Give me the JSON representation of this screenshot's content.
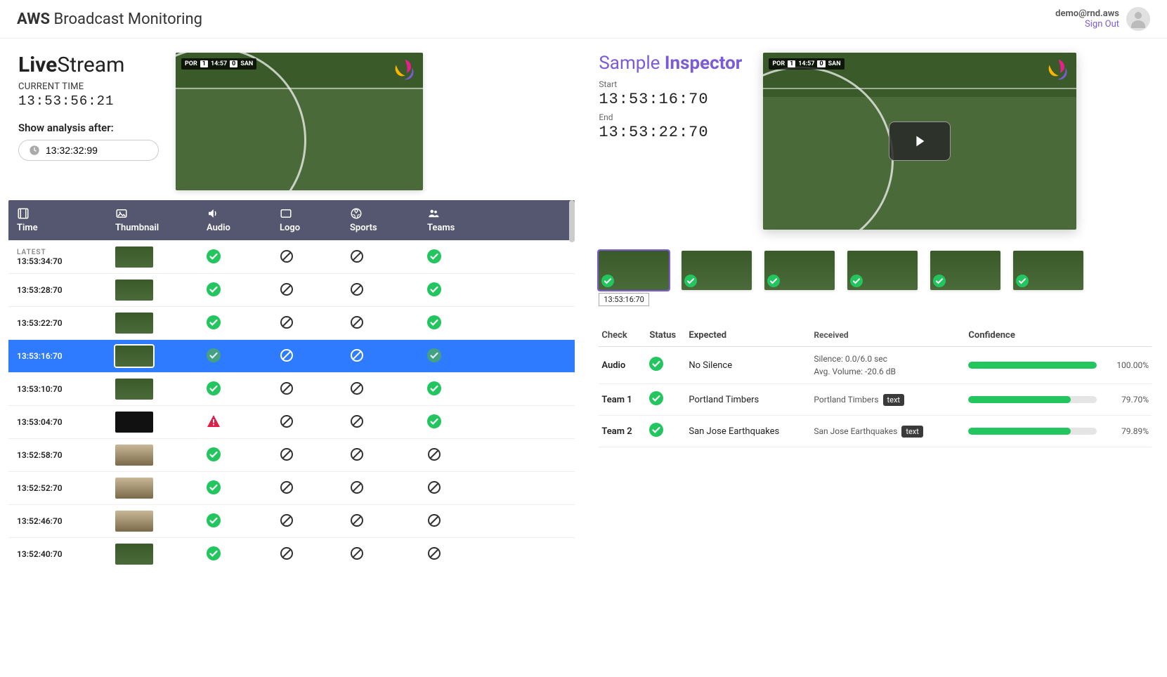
{
  "header": {
    "brand_bold": "AWS",
    "brand_rest": " Broadcast Monitoring",
    "user_email": "demo@rnd.aws",
    "sign_out": "Sign Out"
  },
  "livestream": {
    "title_bold": "Live",
    "title_rest": "Stream",
    "current_time_label": "CURRENT TIME",
    "current_time": "13:53:56:21",
    "analysis_label": "Show analysis after:",
    "analysis_value": "13:32:32:99",
    "scorebug": {
      "t1": "POR",
      "s1": "1",
      "clk": "14:57",
      "s2": "0",
      "t2": "SAN"
    }
  },
  "columns": {
    "time": "Time",
    "thumbnail": "Thumbnail",
    "audio": "Audio",
    "logo": "Logo",
    "sports": "Sports",
    "teams": "Teams"
  },
  "rows": [
    {
      "latest": "LATEST",
      "time": "13:53:34:70",
      "thumb": "field",
      "audio": "ok",
      "logo": "na",
      "sports": "na",
      "teams": "ok",
      "selected": false
    },
    {
      "latest": "",
      "time": "13:53:28:70",
      "thumb": "field",
      "audio": "ok",
      "logo": "na",
      "sports": "na",
      "teams": "ok",
      "selected": false
    },
    {
      "latest": "",
      "time": "13:53:22:70",
      "thumb": "field",
      "audio": "ok",
      "logo": "na",
      "sports": "na",
      "teams": "ok",
      "selected": false
    },
    {
      "latest": "",
      "time": "13:53:16:70",
      "thumb": "field",
      "audio": "ok",
      "logo": "na",
      "sports": "na",
      "teams": "ok",
      "selected": true
    },
    {
      "latest": "",
      "time": "13:53:10:70",
      "thumb": "field",
      "audio": "ok",
      "logo": "na",
      "sports": "na",
      "teams": "ok",
      "selected": false
    },
    {
      "latest": "",
      "time": "13:53:04:70",
      "thumb": "dark",
      "audio": "warn",
      "logo": "na",
      "sports": "na",
      "teams": "ok",
      "selected": false
    },
    {
      "latest": "",
      "time": "13:52:58:70",
      "thumb": "blur",
      "audio": "ok",
      "logo": "na",
      "sports": "na",
      "teams": "na",
      "selected": false
    },
    {
      "latest": "",
      "time": "13:52:52:70",
      "thumb": "blur",
      "audio": "ok",
      "logo": "na",
      "sports": "na",
      "teams": "na",
      "selected": false
    },
    {
      "latest": "",
      "time": "13:52:46:70",
      "thumb": "blur",
      "audio": "ok",
      "logo": "na",
      "sports": "na",
      "teams": "na",
      "selected": false
    },
    {
      "latest": "",
      "time": "13:52:40:70",
      "thumb": "field",
      "audio": "ok",
      "logo": "na",
      "sports": "na",
      "teams": "na",
      "selected": false
    }
  ],
  "inspector": {
    "title_pre": "Sample ",
    "title_bold": "Inspector",
    "start_label": "Start",
    "start_time": "13:53:16:70",
    "end_label": "End",
    "end_time": "13:53:22:70",
    "strip": [
      {
        "time": "13:53:16:70",
        "active": true
      },
      {
        "time": "",
        "active": false
      },
      {
        "time": "",
        "active": false
      },
      {
        "time": "",
        "active": false
      },
      {
        "time": "",
        "active": false
      },
      {
        "time": "",
        "active": false
      }
    ],
    "checks_header": {
      "check": "Check",
      "status": "Status",
      "expected": "Expected",
      "received": "Received",
      "confidence": "Confidence"
    },
    "checks": [
      {
        "name": "Audio",
        "status": "ok",
        "expected": "No Silence",
        "received_lines": [
          "Silence: 0.0/6.0 sec",
          "Avg. Volume: -20.6 dB"
        ],
        "tag": "",
        "confidence_pct": "100.00%",
        "confidence_val": 100
      },
      {
        "name": "Team 1",
        "status": "ok",
        "expected": "Portland Timbers",
        "received_lines": [
          "Portland Timbers"
        ],
        "tag": "text",
        "confidence_pct": "79.70%",
        "confidence_val": 79.7
      },
      {
        "name": "Team 2",
        "status": "ok",
        "expected": "San Jose Earthquakes",
        "received_lines": [
          "San Jose Earthquakes"
        ],
        "tag": "text",
        "confidence_pct": "79.89%",
        "confidence_val": 79.89
      }
    ]
  }
}
